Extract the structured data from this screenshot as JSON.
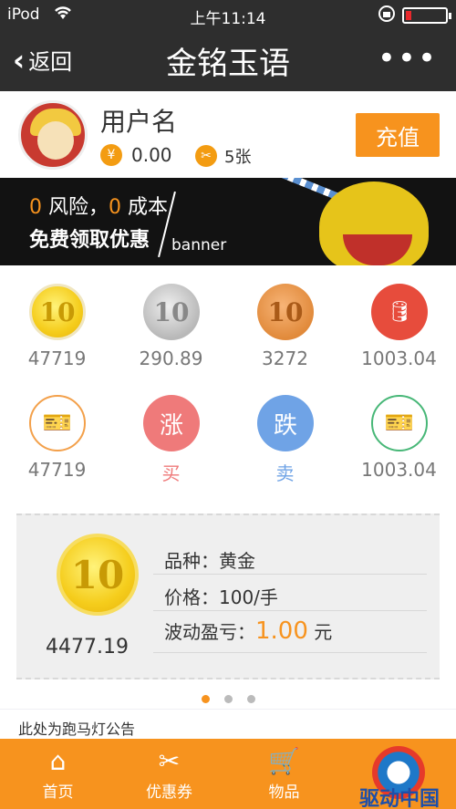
{
  "status": {
    "carrier": "iPod",
    "time": "上午11:14",
    "battery_level": 0.15,
    "battery_color": "#e8282c"
  },
  "nav": {
    "back_label": "返回",
    "title": "金铭玉语",
    "more_label": "•••"
  },
  "user": {
    "name": "用户名",
    "balance": "0.00",
    "coin_symbol": "¥",
    "tickets": "5张",
    "recharge_label": "充值"
  },
  "banner": {
    "zero1": "0",
    "risk": " 风险，",
    "zero2": "0",
    "cost": " 成本",
    "headline": "免费领取优惠",
    "tag": "banner"
  },
  "grid": {
    "items": [
      {
        "icon": "gold-coin-icon",
        "glyph": "10",
        "label": "47719"
      },
      {
        "icon": "silver-coin-icon",
        "glyph": "10",
        "label": "290.89"
      },
      {
        "icon": "bronze-coin-icon",
        "glyph": "10",
        "label": "3272"
      },
      {
        "icon": "oil-barrel-icon",
        "glyph": "🛢",
        "label": "1003.04"
      },
      {
        "icon": "ticket-icon",
        "glyph": "🎫",
        "label": "47719"
      },
      {
        "icon": "rise-icon",
        "glyph": "涨",
        "label": "买"
      },
      {
        "icon": "fall-icon",
        "glyph": "跌",
        "label": "卖"
      },
      {
        "icon": "ticket-green-icon",
        "glyph": "🎫",
        "label": "1003.04"
      }
    ]
  },
  "product": {
    "coin_glyph": "10",
    "amount": "4477.19",
    "variety_label": "品种：",
    "variety": "黄金",
    "price_label": "价格：",
    "price": "100/手",
    "pnl_label": "波动盈亏：",
    "pnl": "1.00",
    "pnl_unit": "元",
    "page_index": 1,
    "page_count": 3
  },
  "notice": "此处为跑马灯公告",
  "tabs": [
    {
      "icon": "home-icon",
      "glyph": "⌂",
      "label": "首页"
    },
    {
      "icon": "coupon-icon",
      "glyph": "✂",
      "label": "优惠券"
    },
    {
      "icon": "cart-icon",
      "glyph": "🛒",
      "label": "物品"
    }
  ],
  "watermark": "驱动中国",
  "colors": {
    "accent": "#f7931e",
    "header": "#2e2e2e",
    "rise": "#ef7a7a",
    "fall": "#6fa3e6"
  }
}
